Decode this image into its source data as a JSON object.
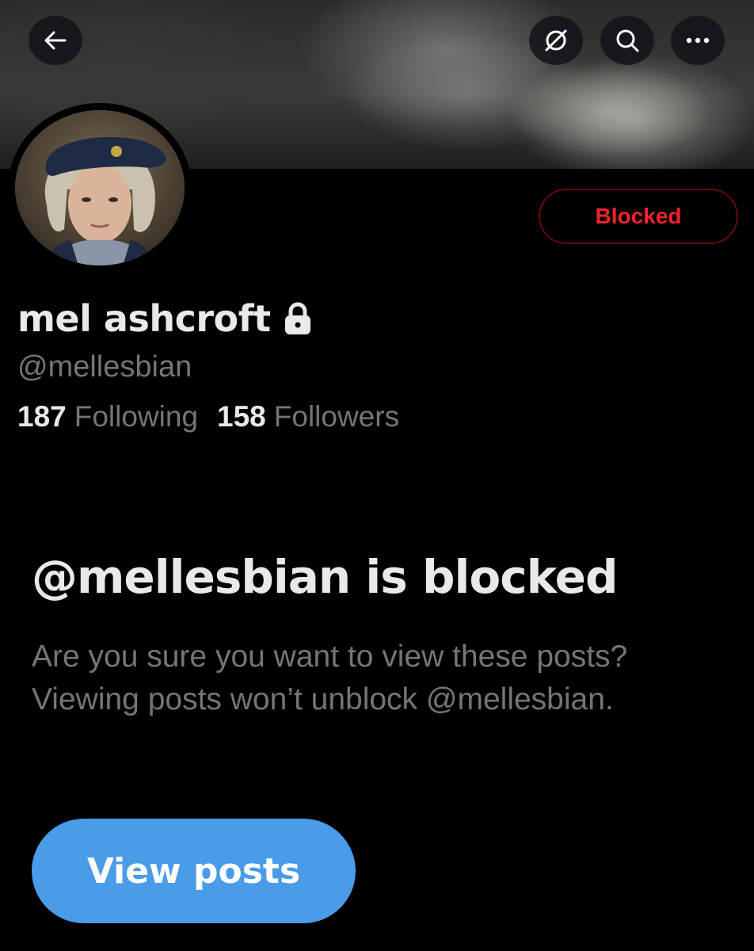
{
  "header": {
    "back_icon": "arrow-left-icon",
    "grok_icon": "grok-icon",
    "search_icon": "search-icon",
    "more_icon": "more-horizontal-icon"
  },
  "profile": {
    "display_name": "mel ashcroft",
    "protected_icon": "lock-icon",
    "handle": "@mellesbian",
    "following_count": "187",
    "following_label": "Following",
    "followers_count": "158",
    "followers_label": "Followers",
    "blocked_button_label": "Blocked"
  },
  "blocked_notice": {
    "title": "@mellesbian is blocked",
    "description": "Are you sure you want to view these posts? Viewing posts won’t unblock @mellesbian.",
    "view_button_label": "View posts"
  },
  "colors": {
    "background": "#000000",
    "primary_text": "#e7e9ea",
    "secondary_text": "#71767b",
    "blocked_red": "#f4212e",
    "blocked_border": "#67070f",
    "view_button": "#4a9be8"
  }
}
